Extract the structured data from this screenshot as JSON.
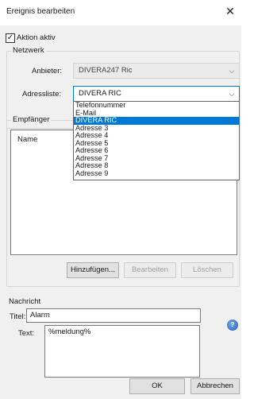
{
  "window": {
    "title": "Ereignis bearbeiten",
    "close_glyph": "✕"
  },
  "active_checkbox": {
    "label": "Aktion aktiv",
    "checked": true
  },
  "network_group": {
    "title": "Netzwerk",
    "provider_label": "Anbieter:",
    "provider_value": "DIVERA247 Ric",
    "addresslist_label": "Adressliste:",
    "addresslist_value": "DIVERA RIC"
  },
  "addresslist_dropdown": {
    "items": [
      {
        "label": "Telefonnummer",
        "selected": false
      },
      {
        "label": "E-Mail",
        "selected": false
      },
      {
        "label": "DIVERA RIC",
        "selected": true
      },
      {
        "label": "Adresse 3",
        "selected": false
      },
      {
        "label": "Adresse 4",
        "selected": false
      },
      {
        "label": "Adresse 5",
        "selected": false
      },
      {
        "label": "Adresse 6",
        "selected": false
      },
      {
        "label": "Adresse 7",
        "selected": false
      },
      {
        "label": "Adresse 8",
        "selected": false
      },
      {
        "label": "Adresse 9",
        "selected": false
      }
    ]
  },
  "recipients_group": {
    "title": "Empfänger",
    "column_name": "Name",
    "add_button": "Hinzufügen...",
    "edit_button": "Bearbeiten",
    "delete_button": "Löschen"
  },
  "message_group": {
    "title": "Nachricht",
    "title_label": "Titel:",
    "title_value": "Alarm",
    "text_label": "Text:",
    "text_value": "%meldung%",
    "help_icon": "help-icon"
  },
  "footer": {
    "ok_button": "OK",
    "cancel_button": "Abbrechen"
  },
  "colors": {
    "selection": "#0078d7",
    "window_bg": "#f0f0f0"
  }
}
